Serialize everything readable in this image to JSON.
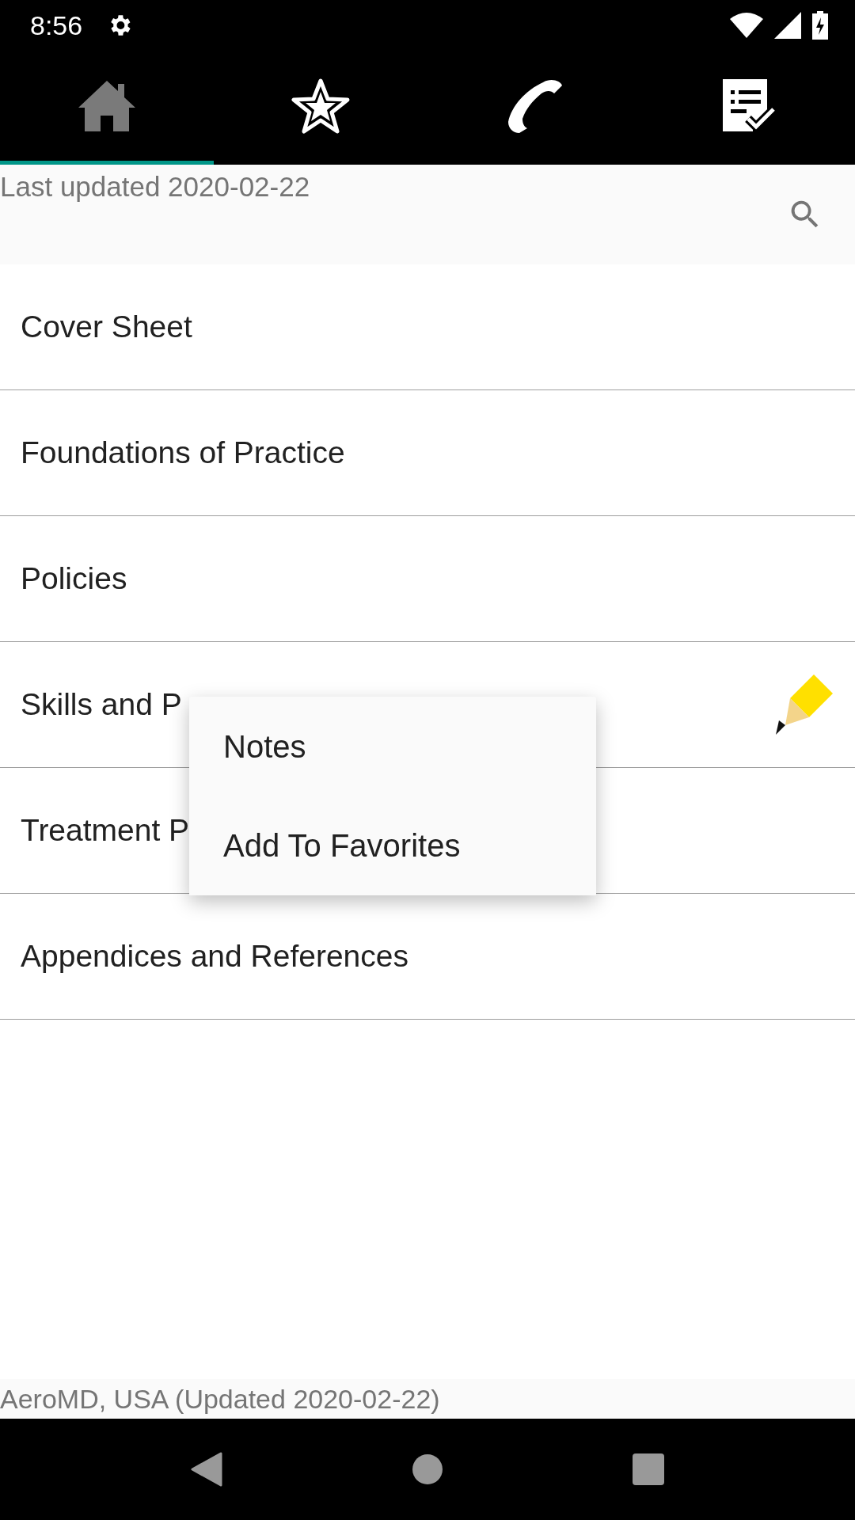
{
  "status_bar": {
    "time": "8:56"
  },
  "tabs": [
    {
      "kind": "home",
      "selected": true
    },
    {
      "kind": "star",
      "selected": false
    },
    {
      "kind": "phone",
      "selected": false
    },
    {
      "kind": "checklist",
      "selected": false
    }
  ],
  "header": {
    "last_updated": "Last updated 2020-02-22"
  },
  "items": [
    {
      "label": "Cover Sheet",
      "has_note": false
    },
    {
      "label": "Foundations of Practice",
      "has_note": false
    },
    {
      "label": "Policies",
      "has_note": false
    },
    {
      "label": "Skills and P",
      "has_note": true
    },
    {
      "label": "Treatment P",
      "has_note": false
    },
    {
      "label": "Appendices and References",
      "has_note": false
    }
  ],
  "context_menu": {
    "items": [
      "Notes",
      "Add To Favorites"
    ]
  },
  "footer": {
    "text": "AeroMD, USA (Updated 2020-02-22)"
  }
}
